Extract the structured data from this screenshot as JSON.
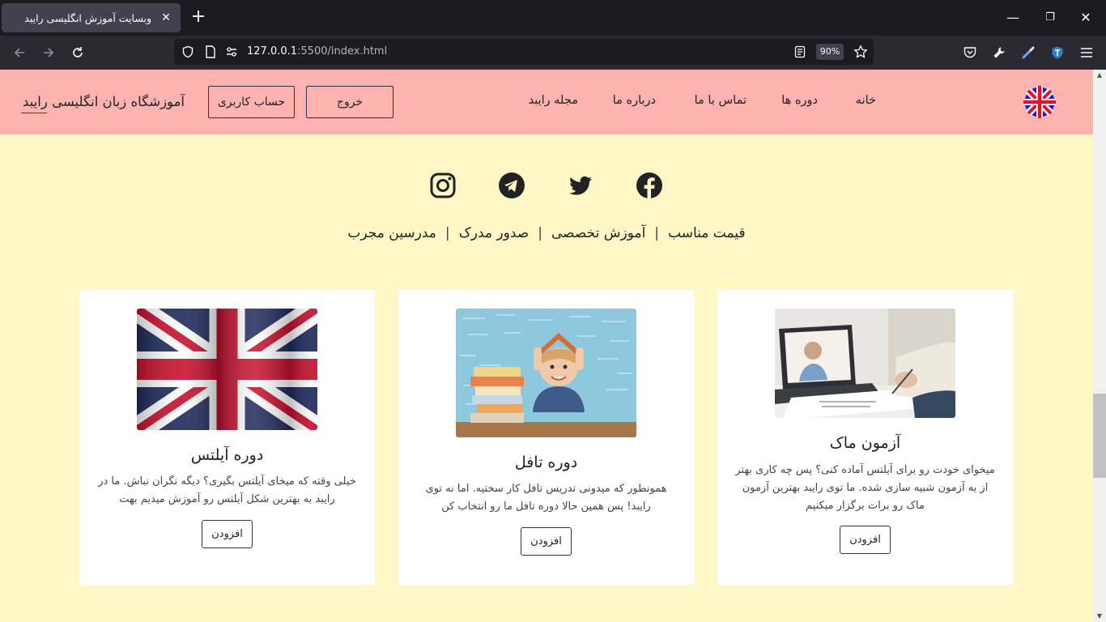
{
  "browser": {
    "tab_title": "وبسایت آموزش انگلیسی رایبد",
    "url_host": "127.0.0.1",
    "url_rest": ":5500/index.html",
    "zoom": "90%"
  },
  "header": {
    "brand": "آموزشگاه زبان انگلیسی رایبد",
    "account_button": "حساب کاربری",
    "logout_button": "خروج",
    "menu": [
      "خانه",
      "دوره ها",
      "تماس با ما",
      "درباره ما",
      "مجله رایبد"
    ]
  },
  "socials": [
    "facebook-icon",
    "twitter-icon",
    "telegram-icon",
    "instagram-icon"
  ],
  "features": [
    "قیمت مناسب",
    "آموزش تخصصی",
    "صدور مدرک",
    "مدرسین مجرب"
  ],
  "cards": [
    {
      "title": "آزمون ماک",
      "text": "میخوای خودت رو برای آیلتس آماده کنی؟ پس چه کاری بهتر از یه آزمون شبیه سازی شده. ما توی رایبد بهترین آزمون ماک رو برات برگزار میکنیم",
      "button": "افزودن",
      "image": "laptop-video-call-photo"
    },
    {
      "title": "دوره تافل",
      "text": "همونطور که میدونی تدریس تافل کار سختیه. اما نه توی رایبد! پس همین حالا دوره تافل ما رو انتخاب کن",
      "button": "افزودن",
      "image": "boy-with-books-photo"
    },
    {
      "title": "دوره آیلتس",
      "text": "خیلی وقته که میخای آیلتس بگیری؟ دیگه نگران نباش. ما در رایبد به بهترین شکل آیلتس رو آموزش میدیم بهت",
      "button": "افزودن",
      "image": "uk-flag-photo"
    }
  ],
  "colors": {
    "header_bg": "#ffb3b0",
    "page_bg": "#fff7c5",
    "card_bg": "#ffffff"
  }
}
